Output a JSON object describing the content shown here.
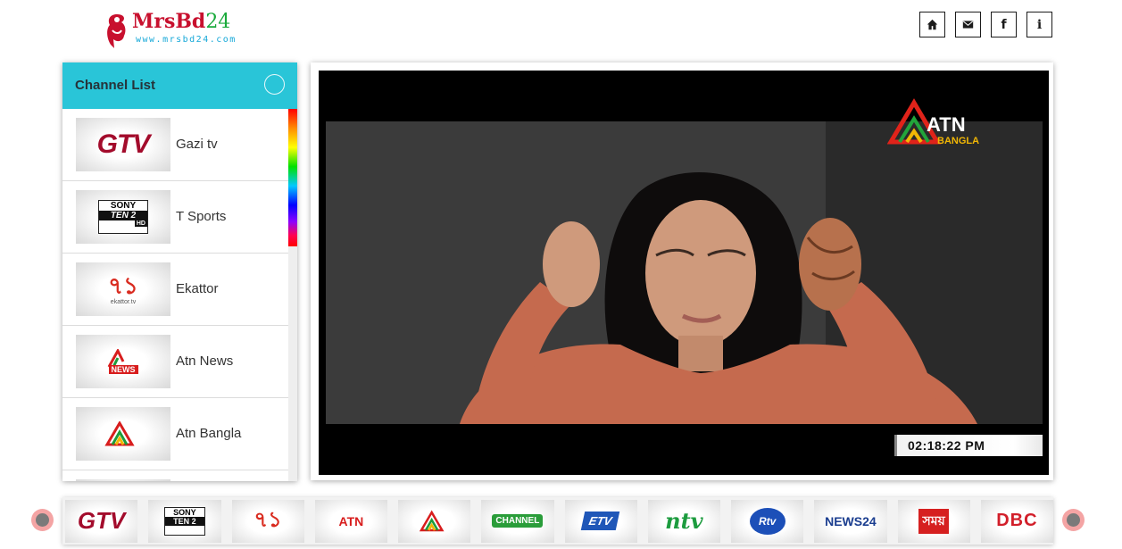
{
  "site": {
    "logo_text": "MrsBd",
    "logo_num": "24",
    "logo_url": "www.mrsbd24.com"
  },
  "nav": [
    {
      "name": "home-icon"
    },
    {
      "name": "mail-icon"
    },
    {
      "name": "facebook-icon",
      "label": "f"
    },
    {
      "name": "info-icon",
      "label": "i"
    }
  ],
  "channel_list": {
    "title": "Channel List",
    "items": [
      {
        "name": "Gazi tv",
        "logo": "gtv-logo"
      },
      {
        "name": "T Sports",
        "logo": "sony-ten2-logo"
      },
      {
        "name": "Ekattor",
        "logo": "ekattor-logo"
      },
      {
        "name": "Atn News",
        "logo": "atn-news-logo"
      },
      {
        "name": "Atn Bangla",
        "logo": "atn-bangla-logo"
      }
    ]
  },
  "player": {
    "channel_logo_text": "ATN",
    "channel_logo_sub": "BANGLA",
    "clock": "02:18:22 PM"
  },
  "carousel": [
    {
      "logo": "gtv-logo"
    },
    {
      "logo": "sony-ten2-logo"
    },
    {
      "logo": "ekattor-logo"
    },
    {
      "logo": "atn-news-logo"
    },
    {
      "logo": "atn-bangla-logo"
    },
    {
      "logo": "channel-i-logo"
    },
    {
      "logo": "etv-logo"
    },
    {
      "logo": "ntv-logo"
    },
    {
      "logo": "rtv-logo"
    },
    {
      "logo": "news24-logo"
    },
    {
      "logo": "somoy-logo"
    },
    {
      "logo": "dbc-logo"
    }
  ],
  "logo_text": {
    "gtv": "GTV",
    "sony": "SONY",
    "ten2": "TEN 2",
    "hd": "HD",
    "ekattor_glyph": "৭১",
    "ekattor_sub": "ekattor.tv",
    "atn": "ATN",
    "news": "NEWS",
    "bangla": "BANGLA",
    "channel": "CHANNEL",
    "etv": "ETV",
    "ntv": "ntv",
    "rtv": "Rtv",
    "news24": "NEWS24",
    "somoy": "সময়",
    "dbc": "DBC"
  },
  "colors": {
    "panel_header": "#29c5d8",
    "logo_red": "#c8102e",
    "logo_green": "#1aaa3c",
    "logo_blue": "#16a8d8"
  }
}
